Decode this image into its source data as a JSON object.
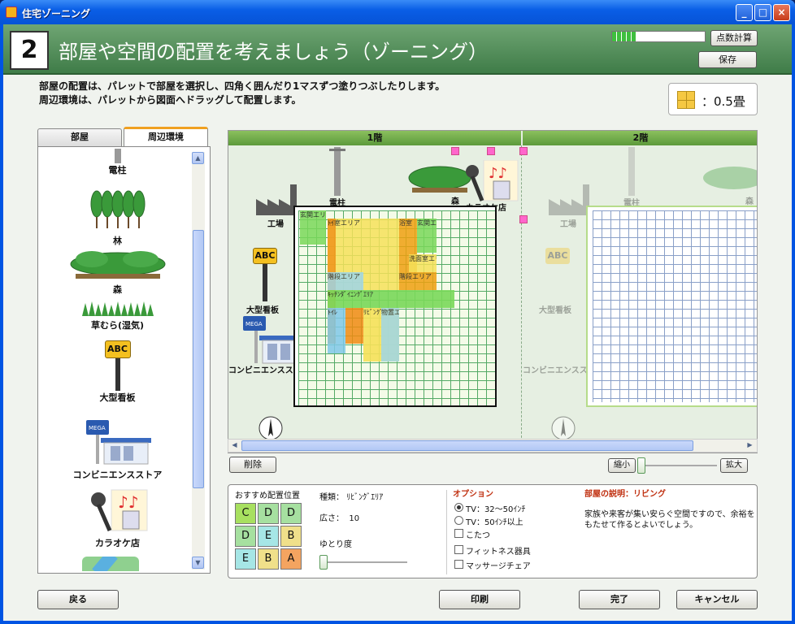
{
  "window": {
    "title": "住宅ゾーニング",
    "min": "_",
    "max": "□",
    "close": "×"
  },
  "header": {
    "step": "2",
    "title": "部屋や空間の配置を考えましょう（ゾーニング）",
    "progress": 0.25
  },
  "buttons": {
    "score": "点数計算",
    "save": "保存",
    "delete": "削除",
    "shrink": "縮小",
    "enlarge": "拡大",
    "back": "戻る",
    "print": "印刷",
    "done": "完了",
    "cancel": "キャンセル"
  },
  "instructions": {
    "line1": "部屋の配置は、パレットで部屋を選択し、四角く囲んだり1マスずつ塗りつぶしたりします。",
    "line2": "周辺環境は、パレットから図面へドラッグして配置します。"
  },
  "tatami": {
    "value": "：0.5畳"
  },
  "tabs": [
    {
      "label": "部屋"
    },
    {
      "label": "周辺環境"
    }
  ],
  "palette": [
    {
      "label": "電柱"
    },
    {
      "label": "林"
    },
    {
      "label": "森"
    },
    {
      "label": "草むら(湿気)"
    },
    {
      "label": "大型看板"
    },
    {
      "label": "コンビニエンスストア"
    },
    {
      "label": "カラオケ店"
    }
  ],
  "canvas": {
    "floors": [
      {
        "label": "1階"
      },
      {
        "label": "2階"
      }
    ],
    "env": {
      "factory": "工場",
      "pole": "電柱",
      "forest": "森",
      "karaoke": "カラオケ店",
      "billboard": "大型看板",
      "conv": "コンビニエンスストア",
      "abc": "ABC",
      "mega": "MEGA"
    },
    "zones": {
      "entrance": "玄関エリア",
      "bath": "浴室エリア",
      "toilet2": "ﾄｲﾚ",
      "bathroom": "浴室",
      "entrance2": "玄関エリア",
      "washroom": "洗面室エリア",
      "stairs1": "階段エリア",
      "stairs2": "階段エリア",
      "kitchen": "ｷｯﾁﾝﾀﾞｲﾆﾝｸﾞｴﾘｱ",
      "toilet": "ﾄｲﾚ",
      "living": "ﾘﾋﾞﾝｸﾞ",
      "storage": "物置エリア"
    }
  },
  "info": {
    "reco_title": "おすすめ配置位置",
    "reco": [
      "C",
      "D",
      "D",
      "D",
      "E",
      "B",
      "E",
      "B",
      "A"
    ],
    "type_label": "種類：",
    "type_value": "ﾘﾋﾞﾝｸﾞｴﾘｱ",
    "area_label": "広さ：",
    "area_value": "10",
    "yutori_label": "ゆとり度",
    "options_title": "オプション",
    "options": [
      {
        "label": "TV：32～50ｲﾝﾁ"
      },
      {
        "label": "TV：50ｲﾝﾁ以上"
      },
      {
        "label": "こたつ"
      },
      {
        "label": "フィットネス器具"
      },
      {
        "label": "マッサージチェア"
      }
    ],
    "desc_title": "部屋の説明：リビング",
    "desc_text": "家族や来客が集い安らぐ空間ですので、余裕をもたせて作るとよいでしょう。"
  },
  "colors": {
    "header": "#4f8a56",
    "A": "#f4a460",
    "B": "#f0e08a",
    "C": "#a8e060",
    "D": "#a6e0a0",
    "E": "#a6e6e6"
  }
}
